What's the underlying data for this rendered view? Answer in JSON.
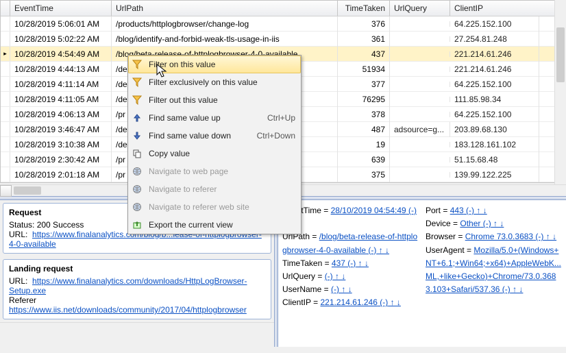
{
  "grid": {
    "headers": {
      "event_time": "EventTime",
      "url_path": "UrlPath",
      "time_taken": "TimeTaken",
      "url_query": "UrlQuery",
      "client_ip": "ClientIP"
    },
    "selected_index": 2,
    "rows": [
      {
        "time": "10/28/2019 5:06:01 AM",
        "url": "/products/httplogbrowser/change-log",
        "tt": "376",
        "q": "",
        "ip": "64.225.152.100"
      },
      {
        "time": "10/28/2019 5:02:22 AM",
        "url": "/blog/identify-and-forbid-weak-tls-usage-in-iis",
        "tt": "361",
        "q": "",
        "ip": "27.254.81.248"
      },
      {
        "time": "10/28/2019 4:54:49 AM",
        "url": "/blog/beta-release-of-httplogbrowser-4-0-available",
        "tt": "437",
        "q": "",
        "ip": "221.214.61.246"
      },
      {
        "time": "10/28/2019 4:44:13 AM",
        "url": "/de",
        "tt": "51934",
        "q": "",
        "ip": "221.214.61.246"
      },
      {
        "time": "10/28/2019 4:11:14 AM",
        "url": "/de",
        "tt": "377",
        "q": "",
        "ip": "64.225.152.100"
      },
      {
        "time": "10/28/2019 4:11:05 AM",
        "url": "/de",
        "tt": "76295",
        "q": "",
        "ip": "111.85.98.34"
      },
      {
        "time": "10/28/2019 4:06:13 AM",
        "url": "/pr",
        "tt": "378",
        "q": "",
        "ip": "64.225.152.100"
      },
      {
        "time": "10/28/2019 3:46:47 AM",
        "url": "/de",
        "tt": "487",
        "q": "adsource=g...",
        "ip": "203.89.68.130"
      },
      {
        "time": "10/28/2019 3:10:38 AM",
        "url": "/de",
        "tt": "19",
        "q": "",
        "ip": "183.128.161.102"
      },
      {
        "time": "10/28/2019 2:30:42 AM",
        "url": "/pr",
        "tt": "639",
        "q": "",
        "ip": "51.15.68.48"
      },
      {
        "time": "10/28/2019 2:01:18 AM",
        "url": "/pr",
        "tt": "375",
        "q": "",
        "ip": "139.99.122.225"
      }
    ]
  },
  "context_menu": {
    "items": [
      {
        "label": "Filter on this value",
        "icon": "funnel",
        "enabled": true,
        "hover": true,
        "shortcut": ""
      },
      {
        "label": "Filter exclusively on this value",
        "icon": "funnel",
        "enabled": true,
        "shortcut": ""
      },
      {
        "label": "Filter out this value",
        "icon": "funnel",
        "enabled": true,
        "shortcut": ""
      },
      {
        "label": "Find same value up",
        "icon": "arrow-up",
        "enabled": true,
        "shortcut": "Ctrl+Up"
      },
      {
        "label": "Find same value down",
        "icon": "arrow-down",
        "enabled": true,
        "shortcut": "Ctrl+Down"
      },
      {
        "label": "Copy value",
        "icon": "copy",
        "enabled": true,
        "shortcut": ""
      },
      {
        "label": "Navigate to web page",
        "icon": "globe",
        "enabled": false,
        "shortcut": ""
      },
      {
        "label": "Navigate to referer",
        "icon": "globe",
        "enabled": false,
        "shortcut": ""
      },
      {
        "label": "Navigate to referer web site",
        "icon": "globe",
        "enabled": false,
        "shortcut": ""
      },
      {
        "label": "Export the current view",
        "icon": "export",
        "enabled": true,
        "shortcut": ""
      }
    ]
  },
  "request_panel": {
    "title": "Request",
    "status_label": "Status:",
    "status_value": "200 Success",
    "url_label": "URL:",
    "url_value": "https://www.finalanalytics.com/blog/b...lease-of-httplogbrowser-4-0-available"
  },
  "landing_panel": {
    "title": "Landing request",
    "url_label": "URL:",
    "url_value": "https://www.finalanalytics.com/downloads/HttpLogBrowser-Setup.exe",
    "referer_label": "Referer",
    "referer_value": "https://www.iis.net/downloads/community/2017/04/httplogbrowser"
  },
  "detail": {
    "left": [
      {
        "k": "EventTime",
        "v": "28/10/2019 04:54:49"
      },
      {
        "k": "UrlPath",
        "v": "/blog/beta-release-of-httplogbrowser-4-0-available"
      },
      {
        "k": "TimeTaken",
        "v": "437"
      },
      {
        "k": "UrlQuery",
        "v": ""
      },
      {
        "k": "UserName",
        "v": ""
      },
      {
        "k": "ClientIP",
        "v": "221.214.61.246"
      }
    ],
    "right": [
      {
        "k": "Port",
        "v": "443"
      },
      {
        "k": "Device",
        "v": "Other"
      },
      {
        "k": "Browser",
        "v": "Chrome 73.0.3683"
      },
      {
        "k": "UserAgent",
        "v": "Mozilla/5.0+(Windows+NT+6.1;+Win64;+x64)+AppleWebK...ML,+like+Gecko)+Chrome/73.0.3683.103+Safari/537.36"
      }
    ],
    "neg": "(-)",
    "arrows": "↑  ↓"
  }
}
